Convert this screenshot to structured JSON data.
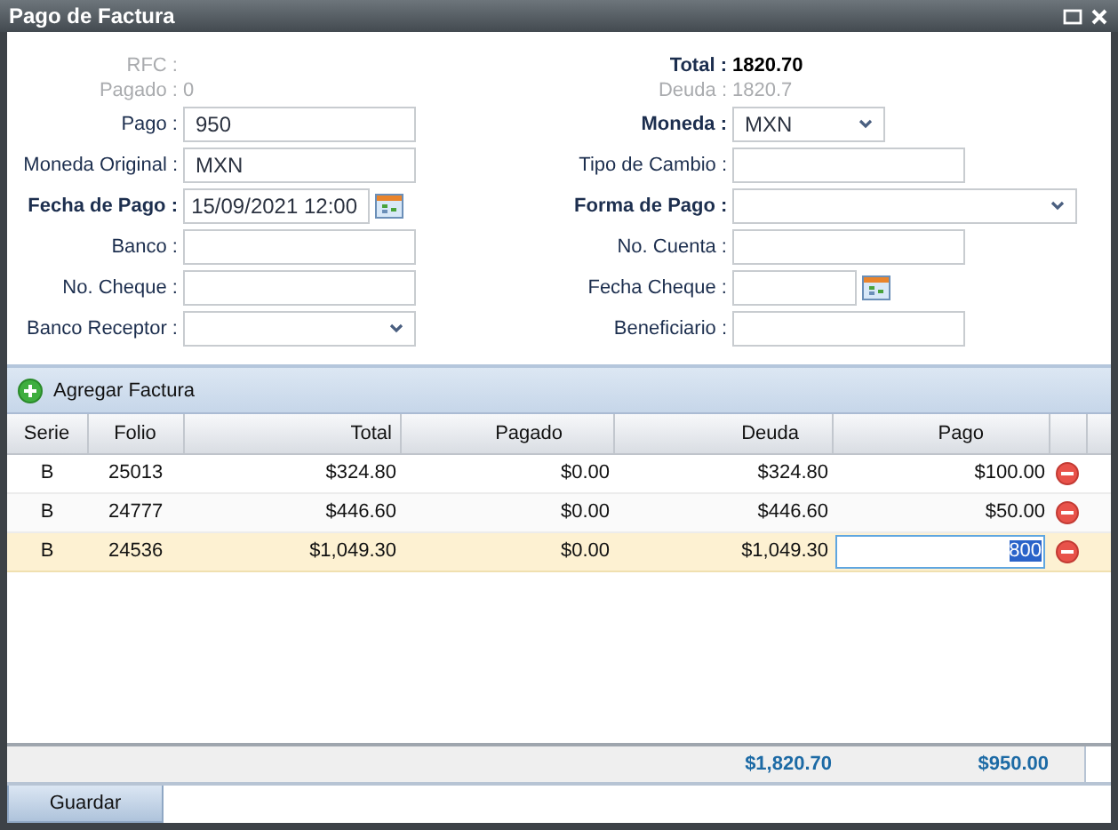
{
  "window": {
    "title": "Pago de Factura"
  },
  "form": {
    "left": [
      {
        "kind": "info",
        "label": "RFC :",
        "required": false,
        "disabled": true
      },
      {
        "kind": "info",
        "label": "Pagado :",
        "value": "0",
        "required": false,
        "disabled": true
      },
      {
        "kind": "input",
        "label": "Pago :",
        "value": "950",
        "required": false,
        "disabled": false
      },
      {
        "kind": "input",
        "label": "Moneda Original :",
        "value": "MXN",
        "required": false,
        "disabled": false
      },
      {
        "kind": "date",
        "label": "Fecha de Pago :",
        "value": "15/09/2021 12:00",
        "required": true,
        "disabled": false
      },
      {
        "kind": "input",
        "label": "Banco :",
        "required": false,
        "disabled": false
      },
      {
        "kind": "input",
        "label": "No. Cheque :",
        "required": false,
        "disabled": false
      },
      {
        "kind": "select",
        "label": "Banco Receptor :",
        "required": false,
        "disabled": false
      }
    ],
    "right": [
      {
        "kind": "info",
        "label": "Total :",
        "value": "1820.70",
        "required": true,
        "disabled": false
      },
      {
        "kind": "info",
        "label": "Deuda :",
        "value": "1820.7",
        "required": false,
        "disabled": true
      },
      {
        "kind": "select",
        "label": "Moneda :",
        "value": "MXN",
        "required": true,
        "disabled": false
      },
      {
        "kind": "input",
        "label": "Tipo de Cambio :",
        "required": false,
        "disabled": false
      },
      {
        "kind": "select",
        "label": "Forma de Pago :",
        "required": true,
        "disabled": false
      },
      {
        "kind": "input",
        "label": "No. Cuenta :",
        "required": false,
        "disabled": false
      },
      {
        "kind": "date",
        "label": "Fecha Cheque :",
        "required": false,
        "disabled": false
      },
      {
        "kind": "input",
        "label": "Beneficiario :",
        "required": false,
        "disabled": false
      }
    ]
  },
  "toolbar": {
    "add_button": "Agregar Factura"
  },
  "table": {
    "columns": [
      "Serie",
      "Folio",
      "Total",
      "Pagado",
      "Deuda",
      "Pago"
    ],
    "rows": [
      {
        "serie": "B",
        "folio": "25013",
        "total": "$324.80",
        "pagado": "$0.00",
        "deuda": "$324.80",
        "pago": "$100.00",
        "selected": false,
        "editing": false
      },
      {
        "serie": "B",
        "folio": "24777",
        "total": "$446.60",
        "pagado": "$0.00",
        "deuda": "$446.60",
        "pago": "$50.00",
        "selected": false,
        "editing": false
      },
      {
        "serie": "B",
        "folio": "24536",
        "total": "$1,049.30",
        "pagado": "$0.00",
        "deuda": "$1,049.30",
        "pago": "800",
        "selected": true,
        "editing": true
      }
    ],
    "summary": {
      "deuda": "$1,820.70",
      "pago": "$950.00"
    }
  },
  "buttons": [
    "Guardar"
  ]
}
